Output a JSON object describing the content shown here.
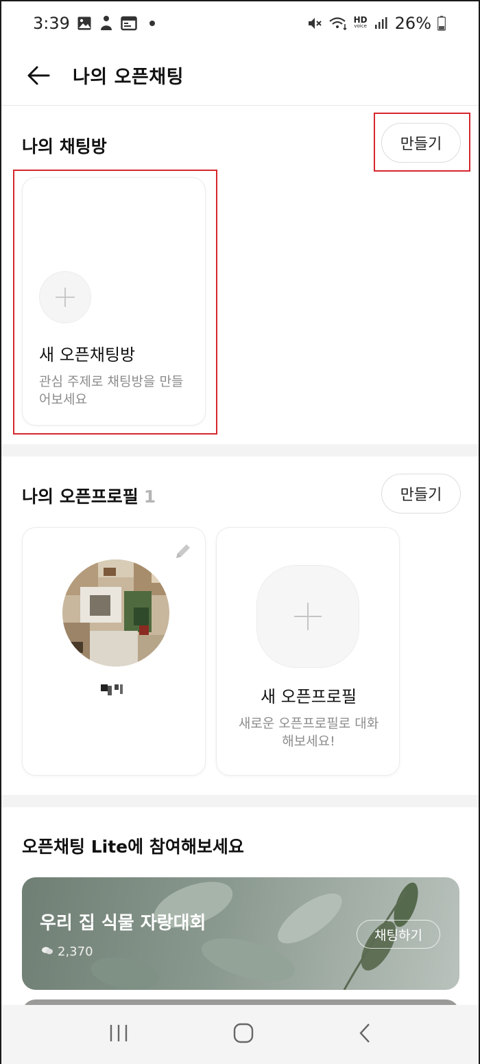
{
  "status": {
    "time": "3:39",
    "battery": "26%",
    "icons": [
      "gallery-icon",
      "person-icon",
      "calendar-icon",
      "notification-dot",
      "mute-icon",
      "wifi-icon",
      "hd-voice-icon",
      "signal-icon",
      "battery-icon"
    ],
    "hd_label": "HD",
    "voice_label": "voice"
  },
  "header": {
    "title": "나의 오픈채팅"
  },
  "chatrooms": {
    "title": "나의 채팅방",
    "create_label": "만들기",
    "new_card": {
      "title": "새 오픈채팅방",
      "desc": "관심 주제로 채팅방을 만들어보세요"
    }
  },
  "profiles": {
    "title": "나의 오픈프로필",
    "count": "1",
    "create_label": "만들기",
    "new_card": {
      "title": "새 오픈프로필",
      "desc": "새로운 오픈프로필로 대화해보세요!"
    }
  },
  "lite": {
    "title": "오픈채팅 Lite에 참여해보세요",
    "banner": {
      "title": "우리 집 식물 자랑대회",
      "count": "2,370",
      "action": "채팅하기"
    }
  },
  "colors": {
    "highlight": "#d5262b",
    "accent_text": "#111111"
  }
}
